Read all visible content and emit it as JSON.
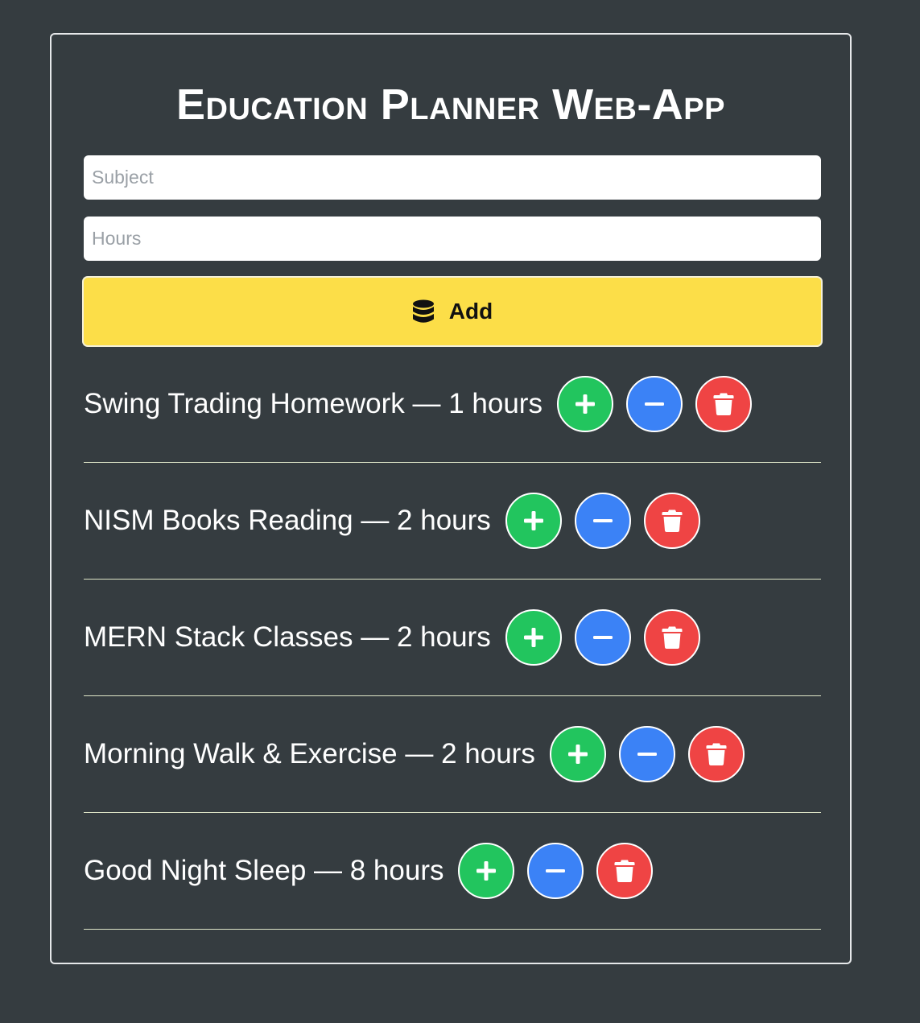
{
  "app": {
    "title": "Education Planner Web-App"
  },
  "form": {
    "subject_placeholder": "Subject",
    "hours_placeholder": "Hours",
    "add_label": "Add",
    "add_icon": "database-icon"
  },
  "items": [
    {
      "subject": "Swing Trading Homework",
      "hours": 1,
      "display": "Swing Trading Homework — 1 hours"
    },
    {
      "subject": "NISM Books Reading",
      "hours": 2,
      "display": "NISM Books Reading — 2 hours"
    },
    {
      "subject": "MERN Stack Classes",
      "hours": 2,
      "display": "MERN Stack Classes — 2 hours"
    },
    {
      "subject": "Morning Walk & Exercise",
      "hours": 2,
      "display": "Morning Walk & Exercise — 2 hours"
    },
    {
      "subject": "Good Night Sleep",
      "hours": 8,
      "display": "Good Night Sleep — 8 hours"
    }
  ],
  "icons": {
    "increase": "plus-icon",
    "decrease": "minus-icon",
    "delete": "trash-icon"
  },
  "colors": {
    "background": "#353c40",
    "add_button": "#fcde48",
    "increase": "#22c55e",
    "decrease": "#3b82f6",
    "delete": "#ef4444"
  }
}
